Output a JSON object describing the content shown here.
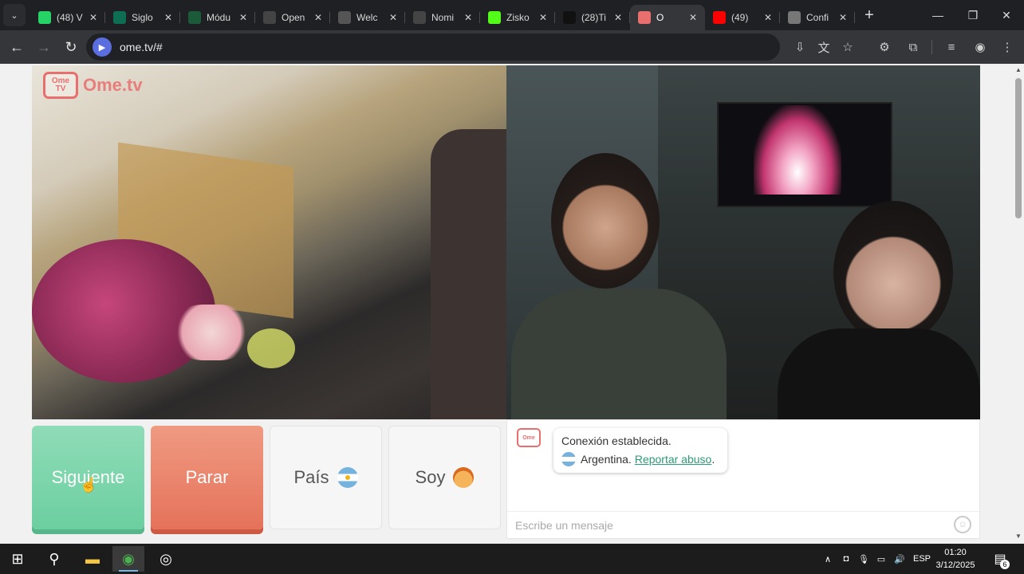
{
  "browser": {
    "tabs": [
      {
        "title": "(48) V",
        "favicon": "whatsapp-icon",
        "color": "#25d366"
      },
      {
        "title": "Siglo",
        "favicon": "siglo21-icon",
        "color": "#0d6e54"
      },
      {
        "title": "Módu",
        "favicon": "moodle-icon",
        "color": "#1c5b3a"
      },
      {
        "title": "Open",
        "favicon": "openai-icon",
        "color": "#444444"
      },
      {
        "title": "Welc",
        "favicon": "globe-icon",
        "color": "#555555"
      },
      {
        "title": "Nomi",
        "favicon": "openai-icon",
        "color": "#444444"
      },
      {
        "title": "Zisko",
        "favicon": "kick-icon",
        "color": "#53fc18"
      },
      {
        "title": "(28)Ti",
        "favicon": "tiktok-icon",
        "color": "#111111"
      },
      {
        "title": "O",
        "favicon": "ometv-icon",
        "color": "#e96f6f",
        "active": true
      },
      {
        "title": "(49)",
        "favicon": "youtube-icon",
        "color": "#ff0000"
      },
      {
        "title": "Confi",
        "favicon": "gear-icon",
        "color": "#777777"
      }
    ],
    "new_tab_glyph": "+",
    "url": "ome.tv/#"
  },
  "page": {
    "logo_tv_top": "Ome",
    "logo_tv_bottom": "TV",
    "logo_brand": "Ome.tv",
    "buttons": {
      "next": "Siguiente",
      "stop": "Parar",
      "country": "País",
      "gender": "Soy"
    },
    "chat": {
      "logo_top": "Ome",
      "logo_bottom": "tv",
      "status": "Conexión establecida.",
      "country": "Argentina.",
      "report_link": "Reportar abuso",
      "report_suffix": ".",
      "input_placeholder": "Escribe un mensaje"
    }
  },
  "taskbar": {
    "language": "ESP",
    "time": "01:20",
    "date": "3/12/2025",
    "notification_count": "6"
  },
  "colors": {
    "next_button": "#6ccfa0",
    "stop_button": "#e5725a",
    "brand": "#e96f6f",
    "link": "#2a9d74"
  }
}
